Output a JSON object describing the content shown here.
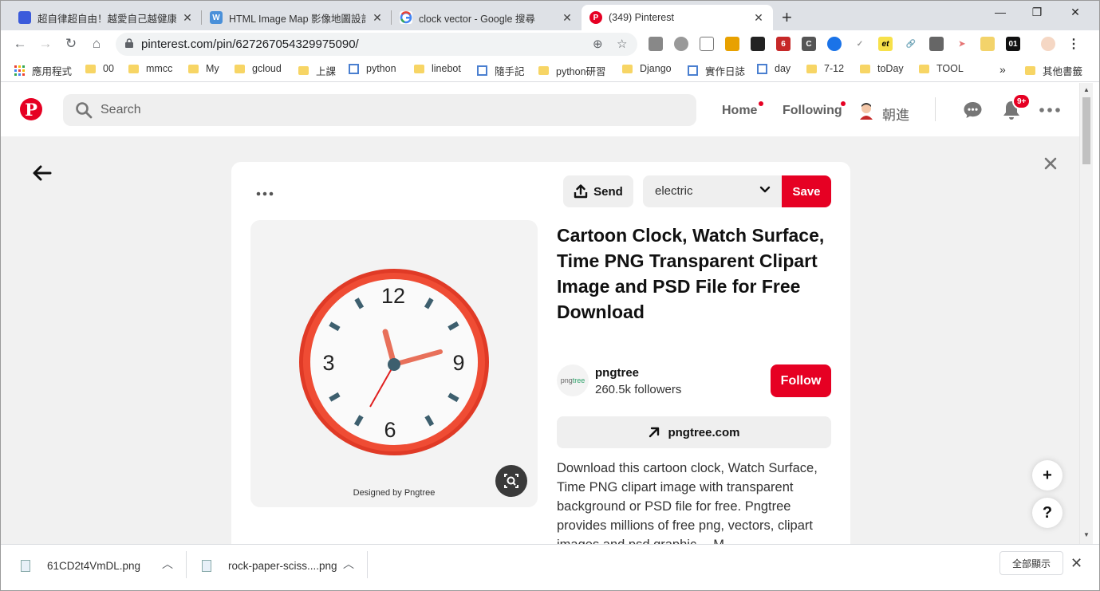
{
  "browser": {
    "tabs": [
      {
        "title": "超自律超自由！越愛自己越健康",
        "active": false
      },
      {
        "title": "HTML Image Map 影像地圖設計",
        "active": false
      },
      {
        "title": "clock vector - Google 搜尋",
        "active": false
      },
      {
        "title": "(349) Pinterest",
        "active": true
      }
    ],
    "new_tab": "+",
    "url": "pinterest.com/pin/627267054329975090/",
    "bookmarks": [
      "應用程式",
      "00",
      "mmcc",
      "My",
      "gcloud",
      "上課",
      "python",
      "linebot",
      "隨手記",
      "python研習",
      "Django",
      "實作日誌",
      "day",
      "7-12",
      "toDay",
      "TOOL"
    ],
    "bookmarks_more": "»",
    "other_bookmarks": "其他書籤",
    "extension_badge": "6",
    "extension_labels": {
      "et": "et",
      "o1": "01"
    }
  },
  "pinterest": {
    "search_placeholder": "Search",
    "nav": {
      "home": "Home",
      "following": "Following",
      "user": "朝進"
    },
    "notifications_badge": "9+",
    "pin": {
      "send_label": "Send",
      "board_value": "electric",
      "save_label": "Save",
      "title": "Cartoon Clock, Watch Surface, Time PNG Transparent Clipart Image and PSD File for Free Download",
      "image_watermark": "Designed by Pngtree",
      "clock_numbers": [
        "12",
        "3",
        "9",
        "6"
      ],
      "publisher": {
        "logo_text": "png",
        "logo_accent": "tree",
        "name": "pngtree",
        "followers": "260.5k followers",
        "follow_label": "Follow"
      },
      "link_label": "pngtree.com",
      "description": "Download this cartoon clock, Watch Surface, Time PNG clipart image with transparent background or PSD file for free. Pngtree provides millions of free png, vectors, clipart images and psd graphic… M"
    },
    "fab": {
      "plus": "+",
      "help": "?"
    }
  },
  "downloads": {
    "items": [
      "61CD2t4VmDL.png",
      "rock-paper-sciss....png"
    ],
    "show_all": "全部顯示"
  },
  "colors": {
    "brand_red": "#e60023",
    "tab_bar": "#dee1e6",
    "content_bg": "#f1f1f1",
    "clock_ring": "#e8432e",
    "clock_hands": "#e8705a"
  }
}
